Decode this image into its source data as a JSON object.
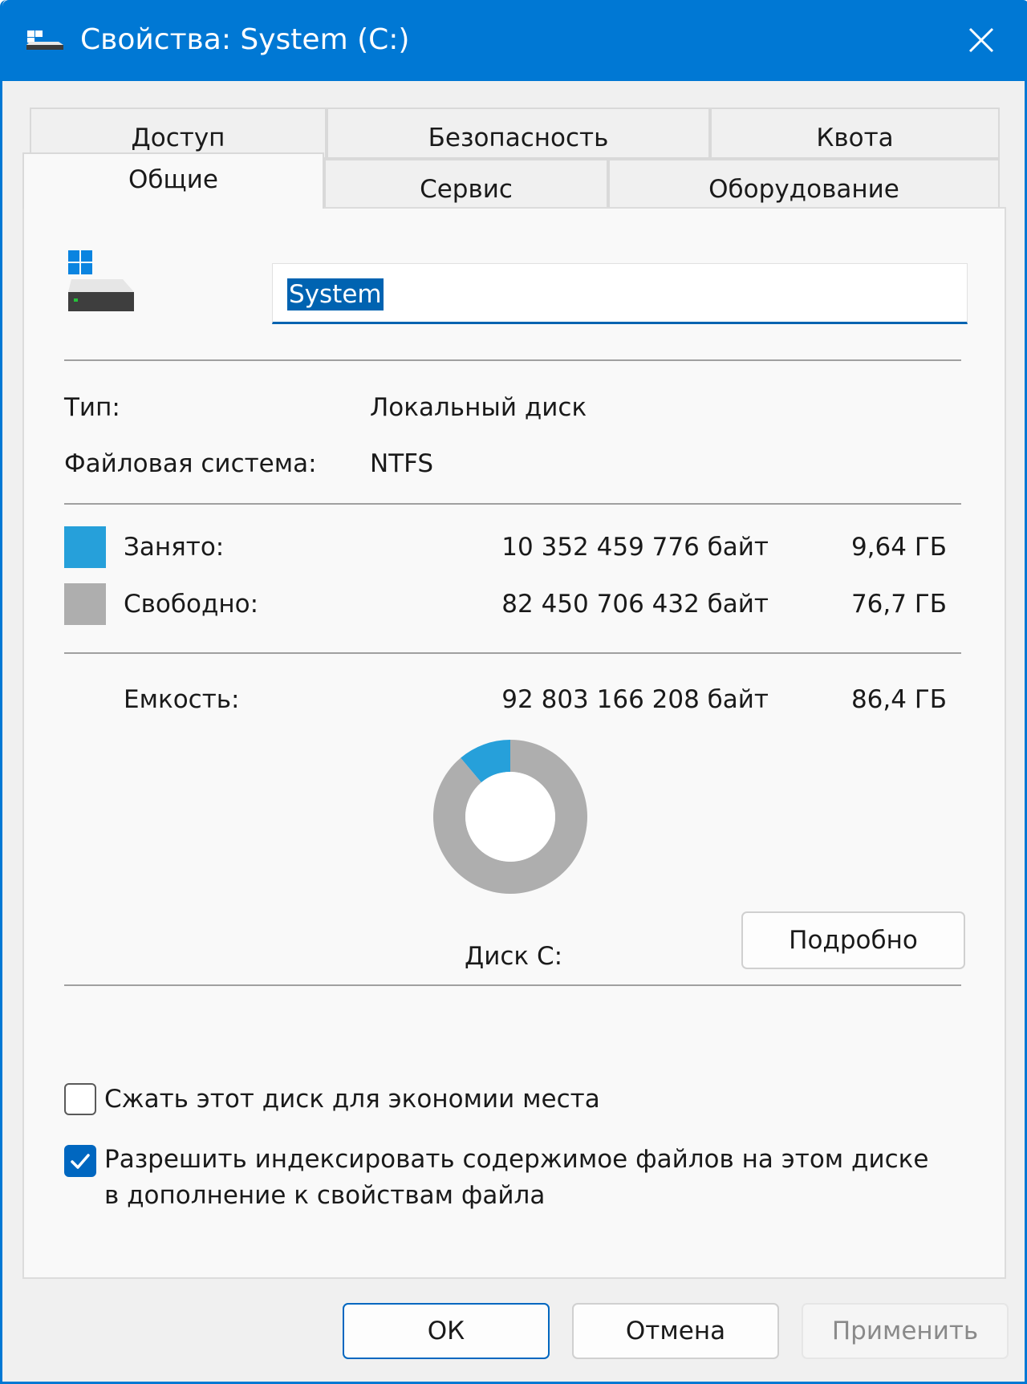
{
  "window": {
    "title": "Свойства: System (C:)",
    "accent_color": "#0078d4"
  },
  "tabs": {
    "row_back": [
      {
        "label": "Доступ"
      },
      {
        "label": "Безопасность"
      },
      {
        "label": "Квота"
      }
    ],
    "row_front": [
      {
        "label": "Общие",
        "active": true
      },
      {
        "label": "Сервис"
      },
      {
        "label": "Оборудование"
      }
    ]
  },
  "general": {
    "volume_name": "System",
    "type_label": "Тип:",
    "type_value": "Локальный диск",
    "fs_label": "Файловая система:",
    "fs_value": "NTFS",
    "used": {
      "label": "Занято:",
      "bytes": "10 352 459 776 байт",
      "size": "9,64 ГБ",
      "color": "#26a0da"
    },
    "free": {
      "label": "Свободно:",
      "bytes": "82 450 706 432 байт",
      "size": "76,7 ГБ",
      "color": "#aeaeae"
    },
    "capacity": {
      "label": "Емкость:",
      "bytes": "92 803 166 208 байт",
      "size": "86,4 ГБ"
    },
    "disk_label": "Диск C:",
    "details_button": "Подробно",
    "compress_label": "Сжать этот диск для экономии места",
    "compress_checked": false,
    "index_label_line1": "Разрешить индексировать содержимое файлов на этом диске",
    "index_label_line2": "в дополнение к свойствам файла",
    "index_checked": true
  },
  "chart_data": {
    "type": "pie",
    "categories": [
      "Занято:",
      "Свободно:"
    ],
    "values": [
      10352459776,
      82450706432
    ],
    "colors": [
      "#26a0da",
      "#aeaeae"
    ]
  },
  "footer": {
    "ok": "ОК",
    "cancel": "Отмена",
    "apply": "Применить",
    "apply_enabled": false
  }
}
